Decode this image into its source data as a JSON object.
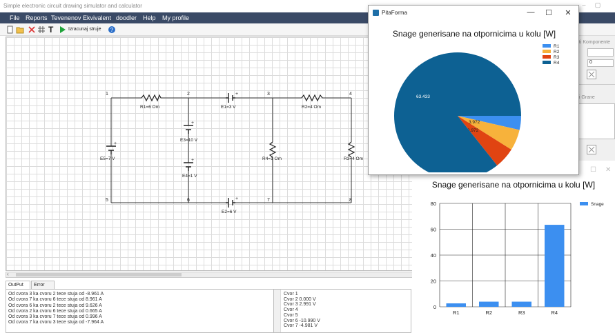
{
  "main_window": {
    "title": "Simple electronic circuit drawing simulator and calculator",
    "minimize_glyph": "–",
    "restore_glyph": "▢"
  },
  "menu": [
    "File",
    "Reports",
    "Tevenenov Ekvivalent",
    "doodler",
    "Help",
    "My profile"
  ],
  "toolbar": {
    "text_tool": "T",
    "calculate_label": "Izracunaj struje",
    "icons": [
      "new-file-icon",
      "open-folder-icon",
      "delete-icon",
      "grid-icon",
      "text-icon",
      "run-icon",
      "help-icon"
    ]
  },
  "circuit": {
    "nodes": [
      "1",
      "2",
      "3",
      "4",
      "5",
      "6",
      "7",
      "8"
    ],
    "components": {
      "R1": "R1=6 Om",
      "E1": "E1=3 V",
      "R2": "R2=4 Om",
      "E3": "E3=10 V",
      "E4": "E4=1 V",
      "E5": "E5=7 V",
      "R4": "R4=1 Om",
      "R3": "R3=4 Om",
      "E2": "E2=6 V"
    }
  },
  "right_panel": {
    "components_label": "uti Komponente",
    "branches_label": "uti Grane",
    "spinner_value": "0"
  },
  "output": {
    "tabs": [
      "OutPut",
      "Error List"
    ],
    "lines": [
      "Od cvora 3 ka cvoru 2 tece stuja od -8.961 A",
      "Od cvora 7 ka cvoru 6 tece stuja od 8.961 A",
      "Od cvora 6 ka cvoru 2 tece stuja od 9.626 A",
      "Od cvora 2 ka cvoru 6 tece stuja od 0.665 A",
      "Od cvora 3 ka cvoru 7 tece stuja od 0.996 A",
      "Od cvora 7 ka cvoru 3 tece stuja od -7.964 A"
    ],
    "node_voltages": [
      "Cvor 1",
      "Cvor 2 0.000 V",
      "Cvor 3 2.991 V",
      "Cvor 4",
      "Cvor 5",
      "Cvor 6 -10.990 V",
      "Cvor 7 -4.981 V"
    ]
  },
  "pie_window": {
    "title": "PitaForma",
    "minimize": "—",
    "maximize": "☐",
    "close": "✕"
  },
  "bar_window": {
    "maximize": "☐",
    "close": "✕"
  },
  "colors": {
    "R1": "#3c8ff0",
    "R2": "#f7b23b",
    "R3": "#e04412",
    "R4": "#0d6193",
    "bar": "#3c8ff0",
    "menubar": "#3a4a66"
  },
  "chart_data": [
    {
      "type": "pie",
      "title": "Snage generisane na otpornicima u kolu [W]",
      "categories": [
        "R1",
        "R2",
        "R3",
        "R4"
      ],
      "values": [
        2.653,
        3.972,
        3.972,
        63.433
      ],
      "data_labels": [
        "2.653",
        "3.972",
        "3.972",
        "63.433"
      ],
      "legend": "top-right"
    },
    {
      "type": "bar",
      "title": "Snage generisane na otpornicima u kolu [W]",
      "categories": [
        "R1",
        "R2",
        "R3",
        "R4"
      ],
      "series": [
        {
          "name": "Snage",
          "values": [
            2.653,
            3.972,
            3.972,
            63.433
          ]
        }
      ],
      "ylim": [
        0,
        80
      ],
      "yticks": [
        0,
        20,
        40,
        60,
        80
      ],
      "grid": true,
      "legend": "top-right"
    }
  ]
}
